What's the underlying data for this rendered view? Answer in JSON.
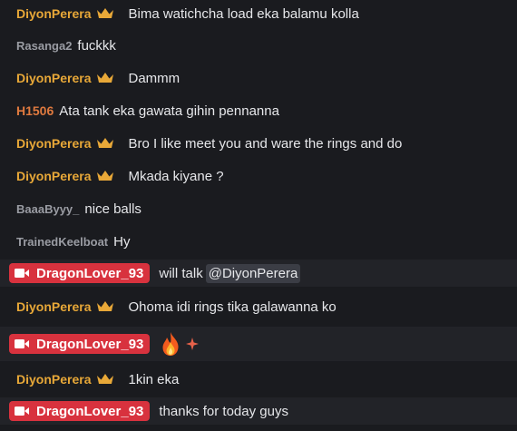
{
  "colors": {
    "background": "#1a1b1f",
    "highlight_row": "#222328",
    "vip_gold": "#e8a838",
    "gray_user": "#9a9ca3",
    "orange_user": "#e07a3f",
    "live_badge": "#d8323e",
    "mention_bg": "#3b3d45"
  },
  "messages": [
    {
      "user": "DiyonPerera",
      "text": "Bima watichcha load eka balamu kolla"
    },
    {
      "user": "Rasanga2",
      "text": "fuckkk"
    },
    {
      "user": "DiyonPerera",
      "text": "Dammm"
    },
    {
      "user": "H1506",
      "text": "Ata tank eka gawata gihin pennanna"
    },
    {
      "user": "DiyonPerera",
      "text": "Bro I like meet you and ware the rings and do"
    },
    {
      "user": "DiyonPerera",
      "text": "Mkada kiyane ?"
    },
    {
      "user": "BaaaByyy_",
      "text": "nice balls"
    },
    {
      "user": "TrainedKeelboat",
      "text": "Hy"
    },
    {
      "user": "DragonLover_93",
      "text": "will talk",
      "mention": "@DiyonPerera"
    },
    {
      "user": "DiyonPerera",
      "text": "Ohoma idi rings tika galawanna ko"
    },
    {
      "user": "DragonLover_93",
      "emojis": [
        "fire-emoji",
        "sparkle-emoji"
      ]
    },
    {
      "user": "DiyonPerera",
      "text": "1kin eka"
    },
    {
      "user": "DragonLover_93",
      "text": "thanks for today guys"
    }
  ]
}
